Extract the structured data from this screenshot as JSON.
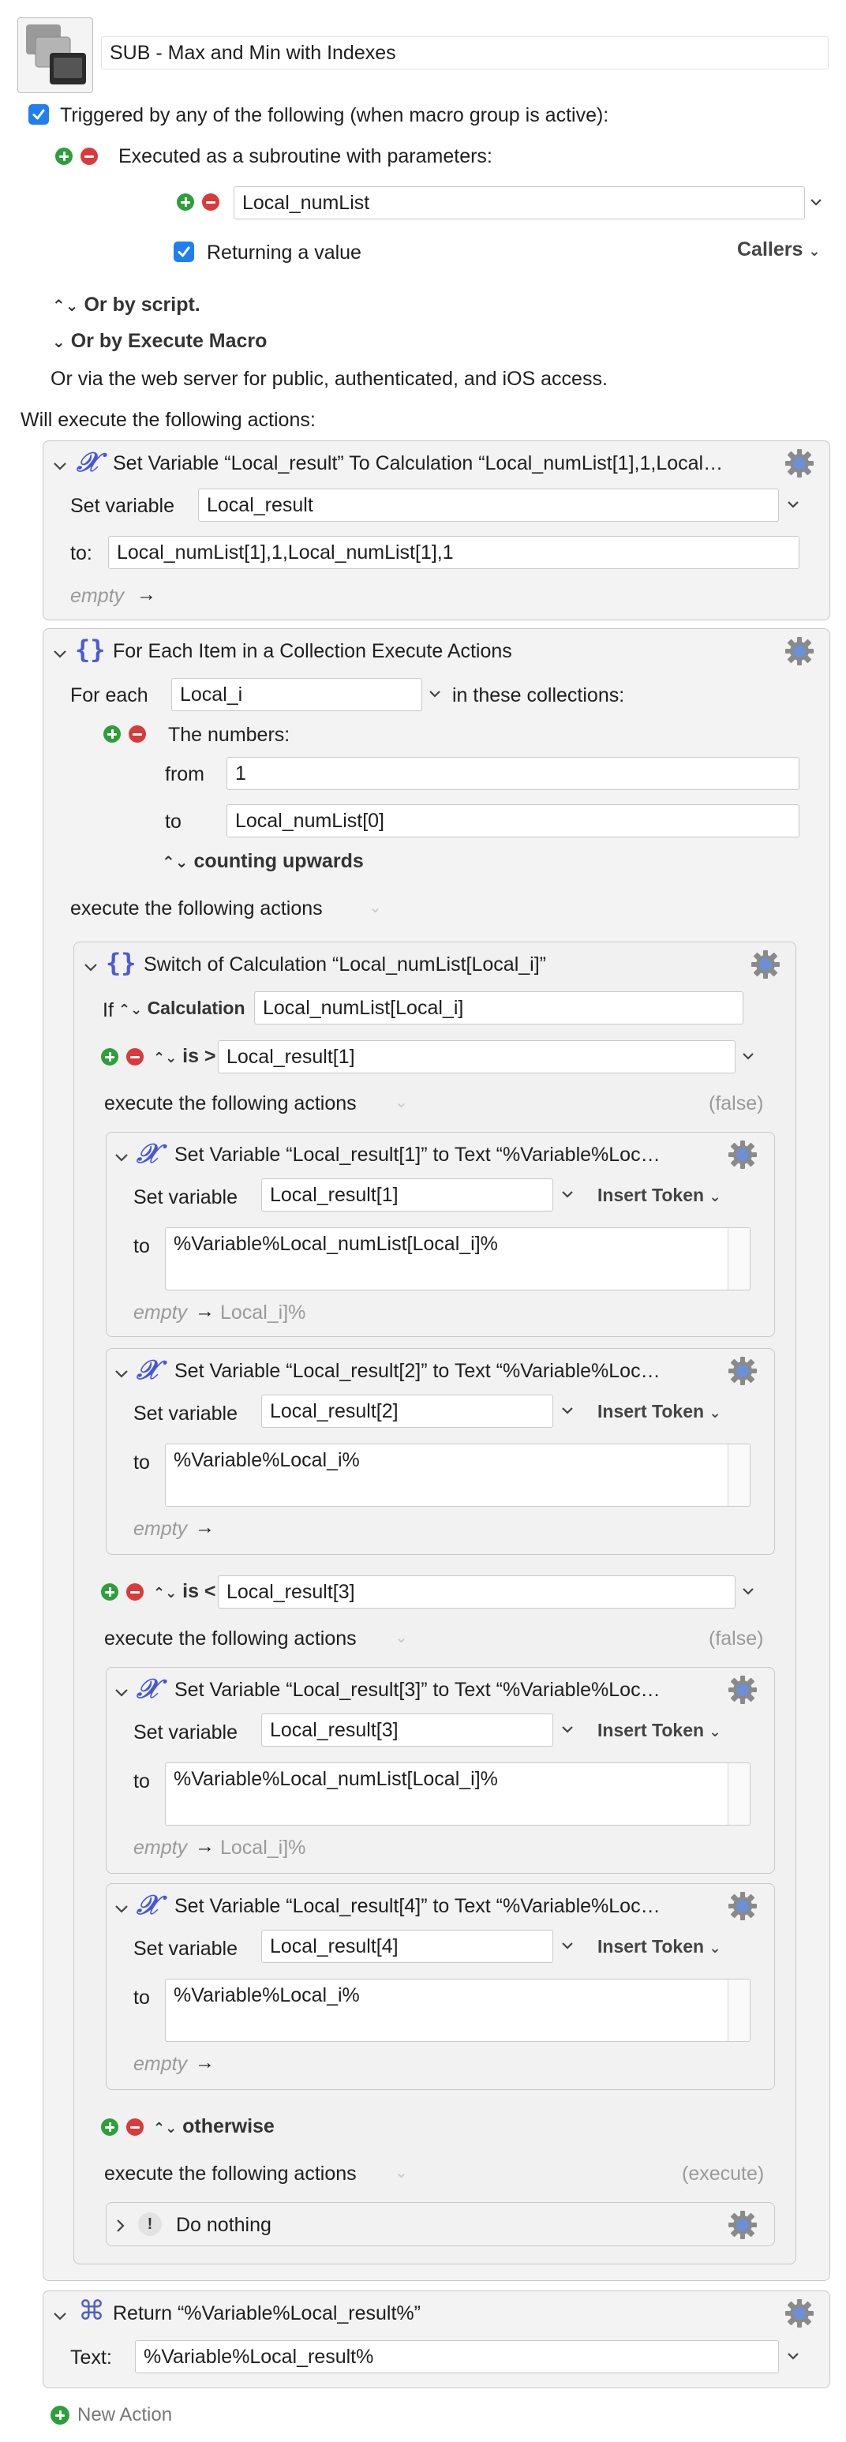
{
  "macro": {
    "title": "SUB - Max and Min with Indexes",
    "triggered_label": "Triggered by any of the following (when macro group is active):",
    "subroutine_label": "Executed as a subroutine with parameters:",
    "param_value": "Local_numList",
    "returning_label": "Returning a value",
    "callers_label": "Callers",
    "or_script": "Or by script.",
    "or_execute": "Or by Execute Macro",
    "web_server": "Or via the web server for public, authenticated, and iOS access.",
    "will_execute": "Will execute the following actions:"
  },
  "a1": {
    "title": "Set Variable “Local_result” To Calculation “Local_numList[1],1,Local…",
    "set_variable_label": "Set variable",
    "variable": "Local_result",
    "to_label": "to:",
    "to_value": "Local_numList[1],1,Local_numList[1],1",
    "empty": "empty",
    "arrow": "→"
  },
  "a2": {
    "title": "For Each Item in a Collection Execute Actions",
    "for_each_label": "For each",
    "variable": "Local_i",
    "in_collections": "in these collections:",
    "numbers_label": "The numbers:",
    "from_label": "from",
    "from_value": "1",
    "to_label": "to",
    "to_value": "Local_numList[0]",
    "counting": "counting upwards",
    "execute_label": "execute the following actions"
  },
  "sw": {
    "title": "Switch of Calculation “Local_numList[Local_i]”",
    "if_label": "If",
    "calc_label": "Calculation",
    "calc_value": "Local_numList[Local_i]",
    "case1_op": "is >",
    "case1_value": "Local_result[1]",
    "execute_label": "execute the following actions",
    "false_label": "(false)",
    "case2_op": "is <",
    "case2_value": "Local_result[3]",
    "otherwise_label": "otherwise",
    "execute_tag": "(execute)",
    "do_nothing": "Do nothing",
    "do_nothing_icon": "!"
  },
  "sv1": {
    "title": "Set Variable “Local_result[1]” to Text “%Variable%Loc…",
    "set_variable_label": "Set variable",
    "variable": "Local_result[1]",
    "insert_token": "Insert Token",
    "to_label": "to",
    "text": "%Variable%Local_numList[Local_i]%",
    "empty": "empty",
    "arrow": "→",
    "preview": "Local_i]%"
  },
  "sv2": {
    "title": "Set Variable “Local_result[2]” to Text “%Variable%Loc…",
    "set_variable_label": "Set variable",
    "variable": "Local_result[2]",
    "insert_token": "Insert Token",
    "to_label": "to",
    "text": "%Variable%Local_i%",
    "empty": "empty",
    "arrow": "→"
  },
  "sv3": {
    "title": "Set Variable “Local_result[3]” to Text “%Variable%Loc…",
    "set_variable_label": "Set variable",
    "variable": "Local_result[3]",
    "insert_token": "Insert Token",
    "to_label": "to",
    "text": "%Variable%Local_numList[Local_i]%",
    "empty": "empty",
    "arrow": "→",
    "preview": "Local_i]%"
  },
  "sv4": {
    "title": "Set Variable “Local_result[4]” to Text “%Variable%Loc…",
    "set_variable_label": "Set variable",
    "variable": "Local_result[4]",
    "insert_token": "Insert Token",
    "to_label": "to",
    "text": "%Variable%Local_i%",
    "empty": "empty",
    "arrow": "→"
  },
  "ret": {
    "title": "Return “%Variable%Local_result%”",
    "text_label": "Text:",
    "text_value": "%Variable%Local_result%"
  },
  "new_action": "New Action",
  "colors": {
    "accent": "#1f7ff0",
    "add": "#2e9f3b",
    "remove": "#d93a3a",
    "action_icon": "#4556d8"
  }
}
